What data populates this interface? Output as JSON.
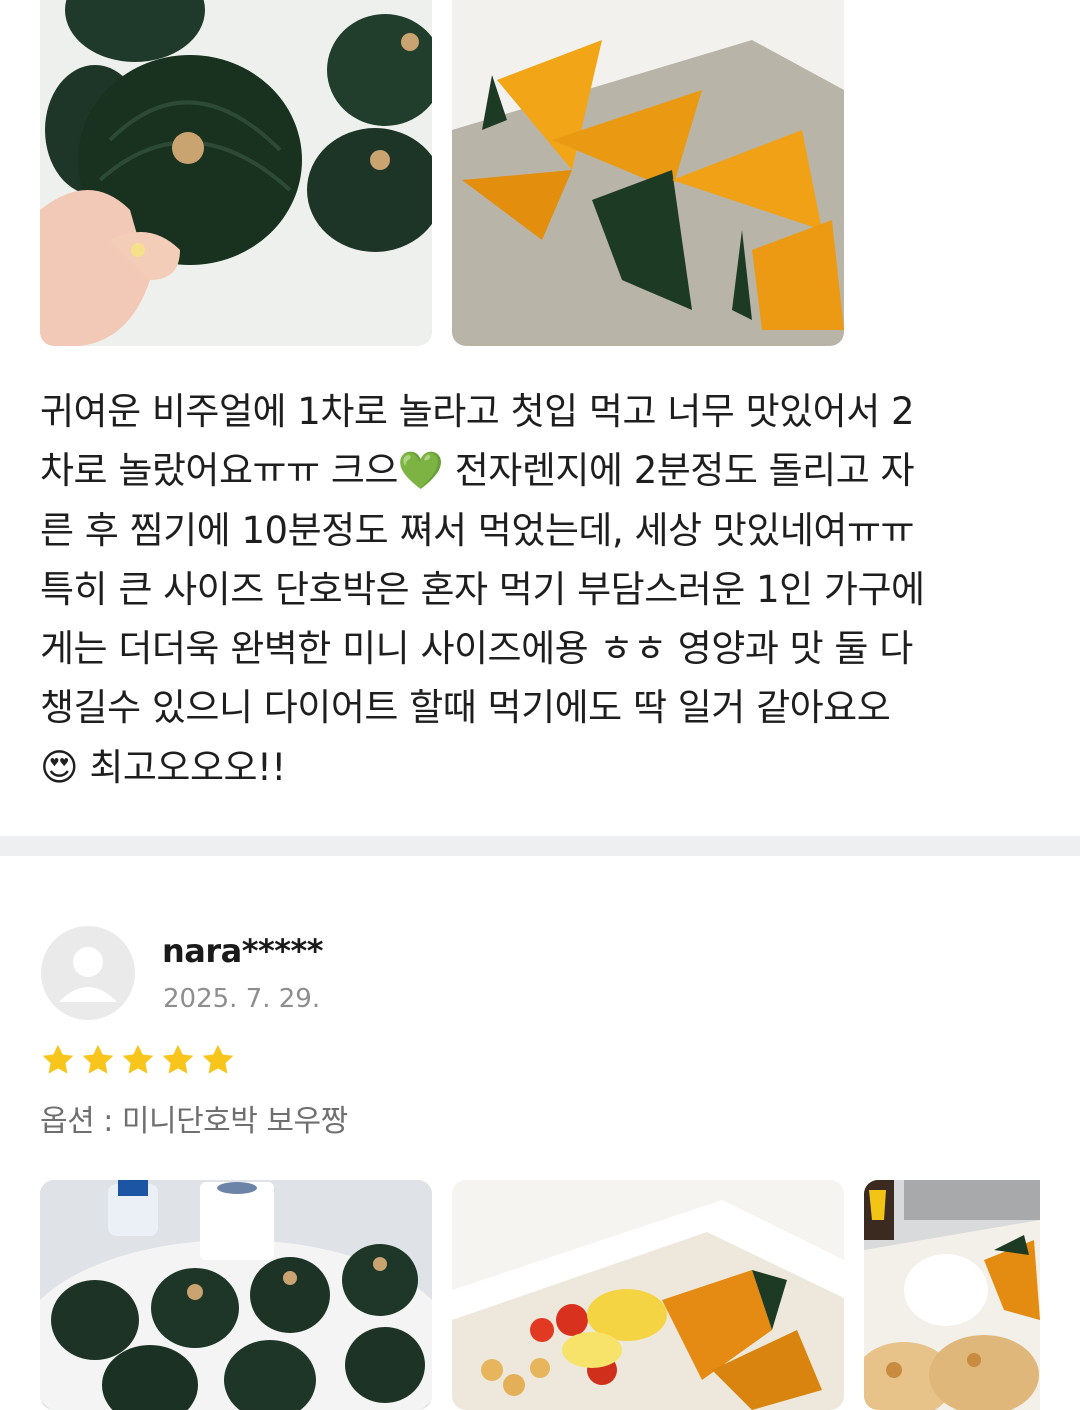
{
  "review_1": {
    "text": "귀여운 비주얼에 1차로 놀라고 첫입 먹고 너무 맛있어서 2\n차로 놀랐어요ㅠㅠ 크으💚 전자렌지에 2분정도 돌리고 자\n른 후 찜기에 10분정도 쪄서 먹었는데, 세상 맛있네여ㅠㅠ\n특히 큰 사이즈 단호박은 혼자 먹기 부담스러운 1인 가구에\n게는 더더욱 완벽한 미니 사이즈에용 ㅎㅎ 영양과 맛 둘 다\n챙길수 있으니 다이어트 할때 먹기에도 딱 일거 같아요오\n😍 최고오오오!!",
    "photos": [
      "green-pumpkins-photo",
      "cooked-pumpkin-slices-photo"
    ]
  },
  "review_2": {
    "reviewer": "nara*****",
    "date": "2025. 7. 29.",
    "rating": 5,
    "option": "옵션 : 미니단호박 보우짱",
    "photos": [
      "pumpkins-on-table-photo",
      "pumpkin-salad-photo",
      "pumpkin-dish-photo"
    ]
  },
  "colors": {
    "star": "#f7c51c",
    "divider": "#eeeff1",
    "meta_text": "#8e8e8e"
  }
}
